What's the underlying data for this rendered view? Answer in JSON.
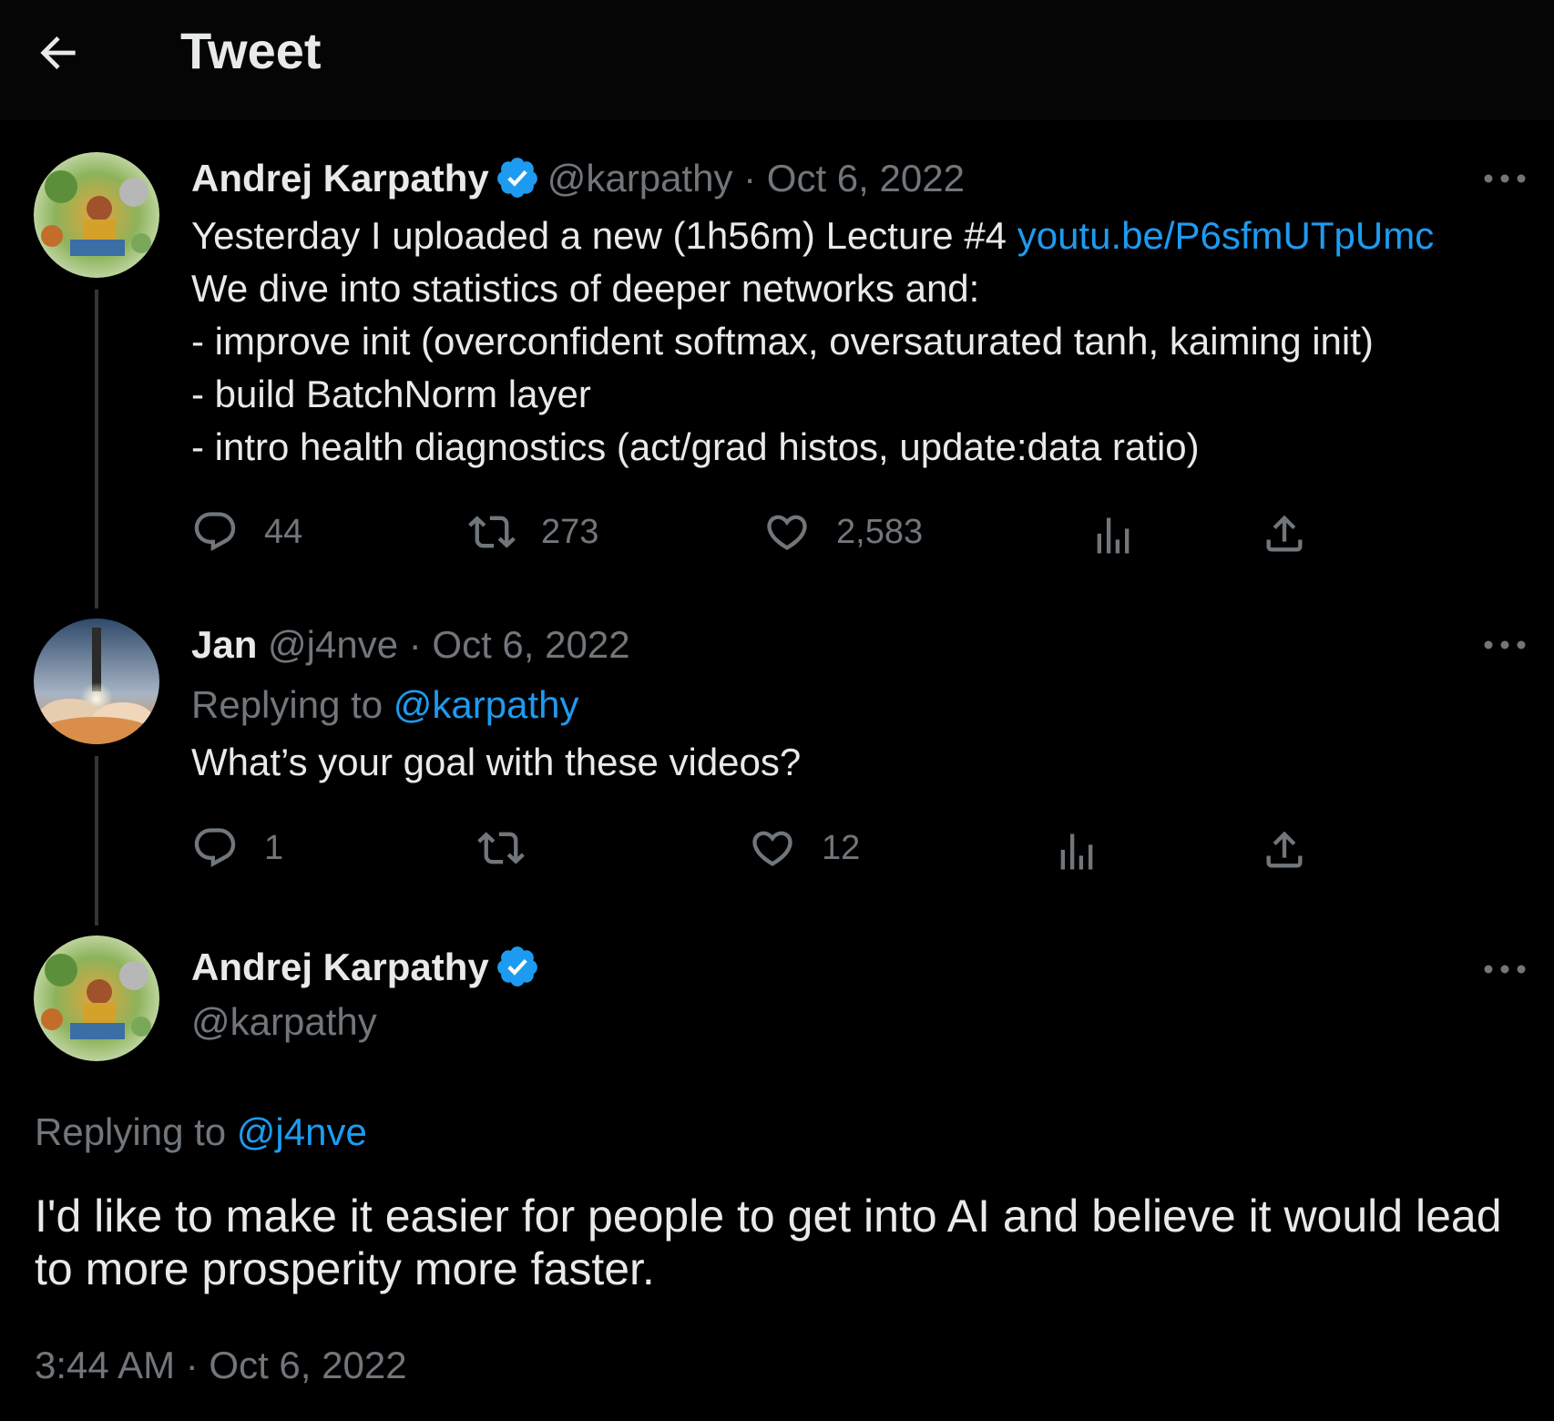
{
  "header": {
    "title": "Tweet",
    "back_icon": "arrow-left-icon"
  },
  "colors": {
    "background": "#000000",
    "text": "#e7e9ea",
    "muted": "#71767b",
    "link": "#1d9bf0",
    "verified": "#1d9bf0"
  },
  "posts": [
    {
      "name": "Andrej Karpathy",
      "handle": "@karpathy",
      "sep": " · ",
      "date": "Oct 6, 2022",
      "line1_text": "Yesterday I uploaded a new (1h56m) Lecture #4 ",
      "line1_link": "youtu.be/P6sfmUTpUmc",
      "rest_text": "We dive into statistics of deeper networks and:\n- improve init (overconfident softmax, oversaturated tanh, kaiming init)\n- build BatchNorm layer\n- intro health diagnostics (act/grad histos, update:data ratio)",
      "replies": "44",
      "retweets": "273",
      "likes": "2,583"
    },
    {
      "name": "Jan",
      "handle": "@j4nve",
      "sep": " · ",
      "date": "Oct 6, 2022",
      "replying_label": "Replying to ",
      "replying_handle": "@karpathy",
      "text": "What’s your goal with these videos?",
      "replies": "1",
      "retweets": "",
      "likes": "12"
    }
  ],
  "focus": {
    "name": "Andrej Karpathy",
    "handle": "@karpathy",
    "replying_label": "Replying to ",
    "replying_handle": "@j4nve",
    "text": "I'd like to make it easier for people to get into AI and believe it would lead to more prosperity more faster.",
    "timestamp": "3:44 AM · Oct 6, 2022"
  }
}
